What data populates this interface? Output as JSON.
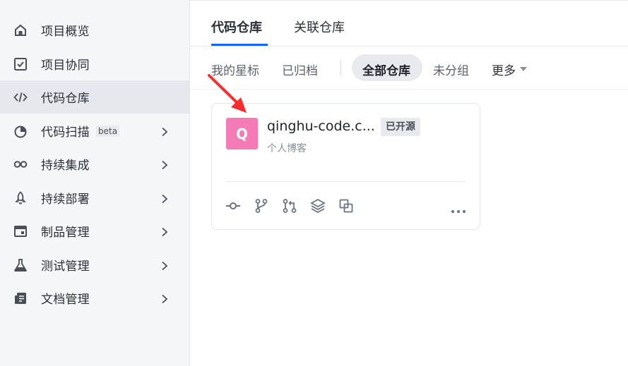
{
  "sidebar": {
    "items": [
      {
        "label": "项目概览",
        "icon": "home-icon",
        "active": false,
        "chevron": false
      },
      {
        "label": "项目协同",
        "icon": "checkbox-icon",
        "active": false,
        "chevron": false
      },
      {
        "label": "代码仓库",
        "icon": "code-icon",
        "active": true,
        "chevron": false
      },
      {
        "label": "代码扫描",
        "icon": "scan-icon",
        "active": false,
        "chevron": true,
        "badge": "beta"
      },
      {
        "label": "持续集成",
        "icon": "infinity-icon",
        "active": false,
        "chevron": true
      },
      {
        "label": "持续部署",
        "icon": "rocket-icon",
        "active": false,
        "chevron": true
      },
      {
        "label": "制品管理",
        "icon": "package-icon",
        "active": false,
        "chevron": true
      },
      {
        "label": "测试管理",
        "icon": "flask-icon",
        "active": false,
        "chevron": true
      },
      {
        "label": "文档管理",
        "icon": "document-icon",
        "active": false,
        "chevron": true
      }
    ]
  },
  "tabs": {
    "code_repo": "代码仓库",
    "linked_repo": "关联仓库"
  },
  "filters": {
    "starred": "我的星标",
    "archived": "已归档",
    "all": "全部仓库",
    "ungrouped": "未分组",
    "more": "更多"
  },
  "repo": {
    "avatar_letter": "Q",
    "name": "qinghu-code.c...",
    "badge": "已开源",
    "description": "个人博客",
    "actions": [
      "commit-icon",
      "branch-icon",
      "merge-request-icon",
      "layers-icon",
      "copy-icon"
    ]
  },
  "colors": {
    "accent": "#1664ff",
    "avatar": "#f57bb6",
    "annotation_arrow": "#ff2b2b"
  }
}
